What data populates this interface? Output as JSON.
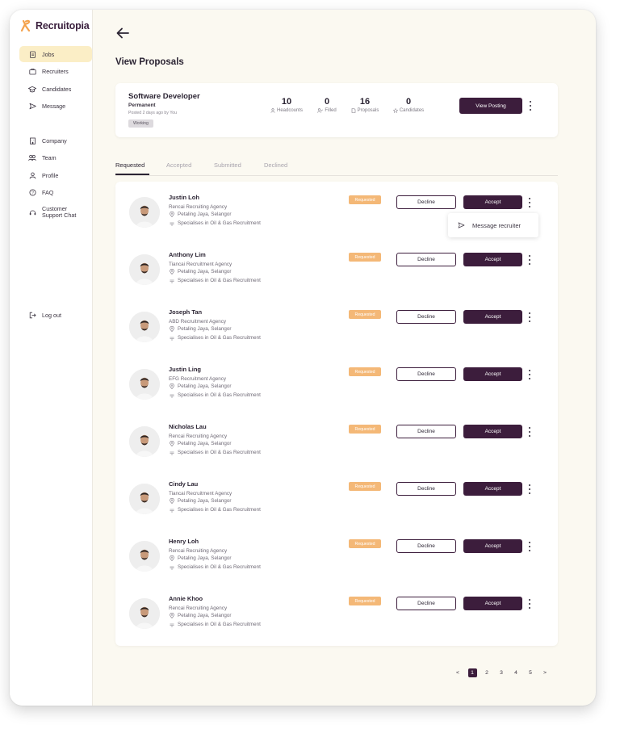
{
  "brand": {
    "name": "Recruitopia",
    "logo_icon": "r-logo-icon",
    "accent": "#f4a24c"
  },
  "sidebar": {
    "items": [
      {
        "label": "Jobs",
        "icon": "clipboard-icon",
        "active": true
      },
      {
        "label": "Recruiters",
        "icon": "briefcase-icon"
      },
      {
        "label": "Candidates",
        "icon": "graduation-cap-icon"
      },
      {
        "label": "Message",
        "icon": "send-icon"
      },
      {
        "label": "Company",
        "icon": "building-icon"
      },
      {
        "label": "Team",
        "icon": "team-icon"
      },
      {
        "label": "Profile",
        "icon": "user-icon"
      },
      {
        "label": "FAQ",
        "icon": "help-icon"
      },
      {
        "label": "Customer Support Chat",
        "icon": "headset-icon"
      }
    ],
    "logout": "Log out"
  },
  "page": {
    "title": "View Proposals"
  },
  "job": {
    "title": "Software Developer",
    "type": "Permanent",
    "posted": "Posted 2 days ago by You",
    "status": "Working",
    "stats": [
      {
        "value": "10",
        "label": "Headcounts",
        "icon": "person-icon"
      },
      {
        "value": "0",
        "label": "Filled",
        "icon": "person-check-icon"
      },
      {
        "value": "16",
        "label": "Proposals",
        "icon": "document-icon"
      },
      {
        "value": "0",
        "label": "Candidates",
        "icon": "star-icon"
      }
    ],
    "view_button": "View Posting"
  },
  "tabs": [
    "Requested",
    "Accepted",
    "Submitted",
    "Declined"
  ],
  "recruiters": [
    {
      "name": "Justin Loh",
      "agency": "Rencai Recruiting Agency",
      "location": "Petaling Jaya, Selangor",
      "specialty": "Specialises in Oil & Gas Recruitment",
      "status": "Requested"
    },
    {
      "name": "Anthony Lim",
      "agency": "Tiancai Recruitment Agency",
      "location": "Petaling Jaya, Selangor",
      "specialty": "Specialises in Oil & Gas Recruitment",
      "status": "Requested"
    },
    {
      "name": "Joseph Tan",
      "agency": "ABD Recruitment Agency",
      "location": "Petaling Jaya, Selangor",
      "specialty": "Specialises in Oil & Gas Recruitment",
      "status": "Requested"
    },
    {
      "name": "Justin Ling",
      "agency": "EFG Recruitment Agency",
      "location": "Petaling Jaya, Selangor",
      "specialty": "Specialises in Oil & Gas Recruitment",
      "status": "Requested"
    },
    {
      "name": "Nicholas Lau",
      "agency": "Rencai Recruiting Agency",
      "location": "Petaling Jaya, Selangor",
      "specialty": "Specialises in Oil & Gas Recruitment",
      "status": "Requested"
    },
    {
      "name": "Cindy Lau",
      "agency": "Tiancai Recruitment Agency",
      "location": "Petaling Jaya, Selangor",
      "specialty": "Specialises in Oil & Gas Recruitment",
      "status": "Requested"
    },
    {
      "name": "Henry Loh",
      "agency": "Rencai Recruiting Agency",
      "location": "Petaling Jaya, Selangor",
      "specialty": "Specialises in Oil & Gas Recruitment",
      "status": "Requested"
    },
    {
      "name": "Annie Khoo",
      "agency": "Rencai Recruiting Agency",
      "location": "Petaling Jaya, Selangor",
      "specialty": "Specialises in Oil & Gas Recruitment",
      "status": "Requested"
    }
  ],
  "actions": {
    "decline": "Decline",
    "accept": "Accept"
  },
  "popover": {
    "label": "Message recruiter"
  },
  "pagination": {
    "prev": "<",
    "pages": [
      "1",
      "2",
      "3",
      "4",
      "5"
    ],
    "current": "1",
    "next": ">"
  }
}
